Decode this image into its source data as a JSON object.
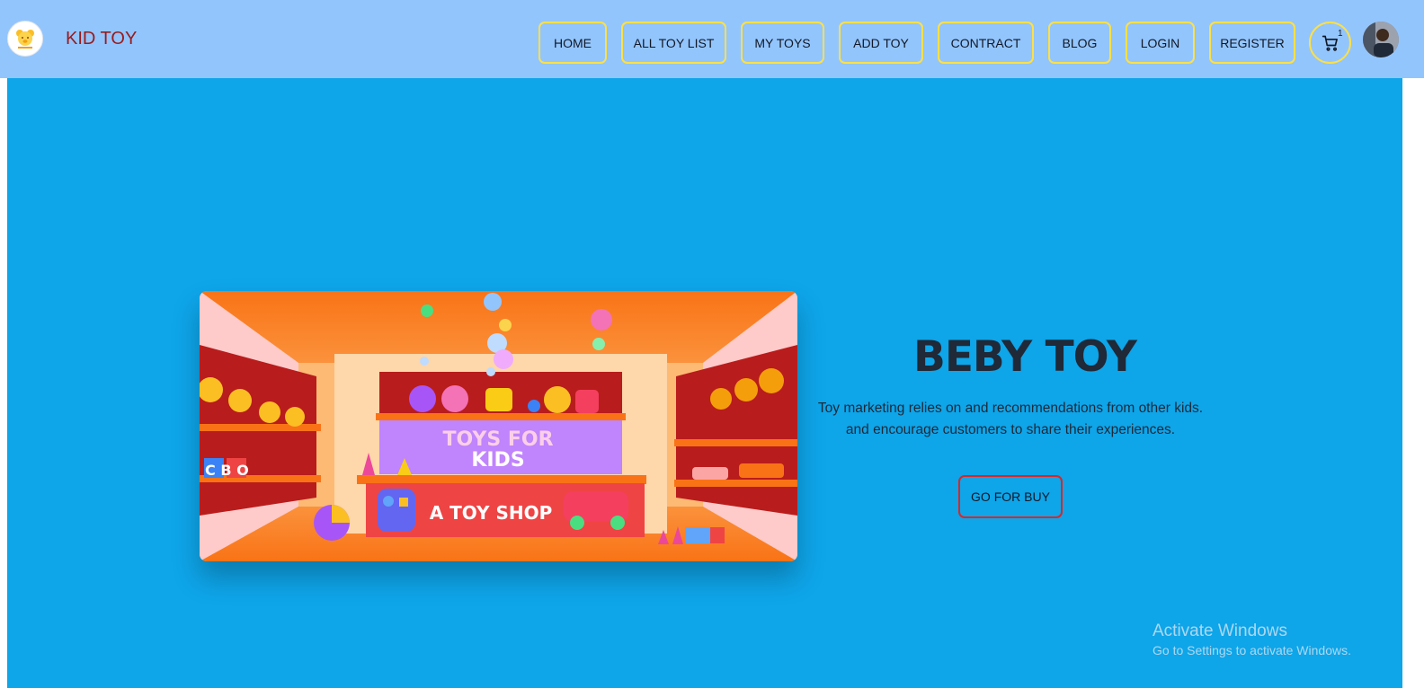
{
  "navbar": {
    "brand": "KID TOY",
    "items": [
      {
        "label": "HOME"
      },
      {
        "label": "ALL TOY LIST"
      },
      {
        "label": "MY TOYS"
      },
      {
        "label": "ADD TOY"
      },
      {
        "label": "CONTRACT"
      },
      {
        "label": "BLOG"
      },
      {
        "label": "LOGIN"
      },
      {
        "label": "REGISTER"
      }
    ],
    "cart_count": "1",
    "cart_icon": "cart-icon",
    "logo_icon": "teddy-bear-icon"
  },
  "hero": {
    "title": "BEBY TOY",
    "description_line1": "Toy marketing relies on and recommendations from other kids.",
    "description_line2": "and encourage customers to share their experiences.",
    "button_label": "GO FOR BUY",
    "image": {
      "sign_line1": "TOYS FOR",
      "sign_line2": "KIDS",
      "counter_text": "A TOY SHOP",
      "blocks_text": "C B O"
    }
  },
  "watermark": {
    "title": "Activate Windows",
    "subtitle": "Go to Settings to activate Windows."
  },
  "colors": {
    "navbar_bg": "#93c5fd",
    "hero_bg": "#0ea5e9",
    "brand_text": "#991b1b",
    "nav_border": "#fde047",
    "buy_border": "#dc2626"
  }
}
